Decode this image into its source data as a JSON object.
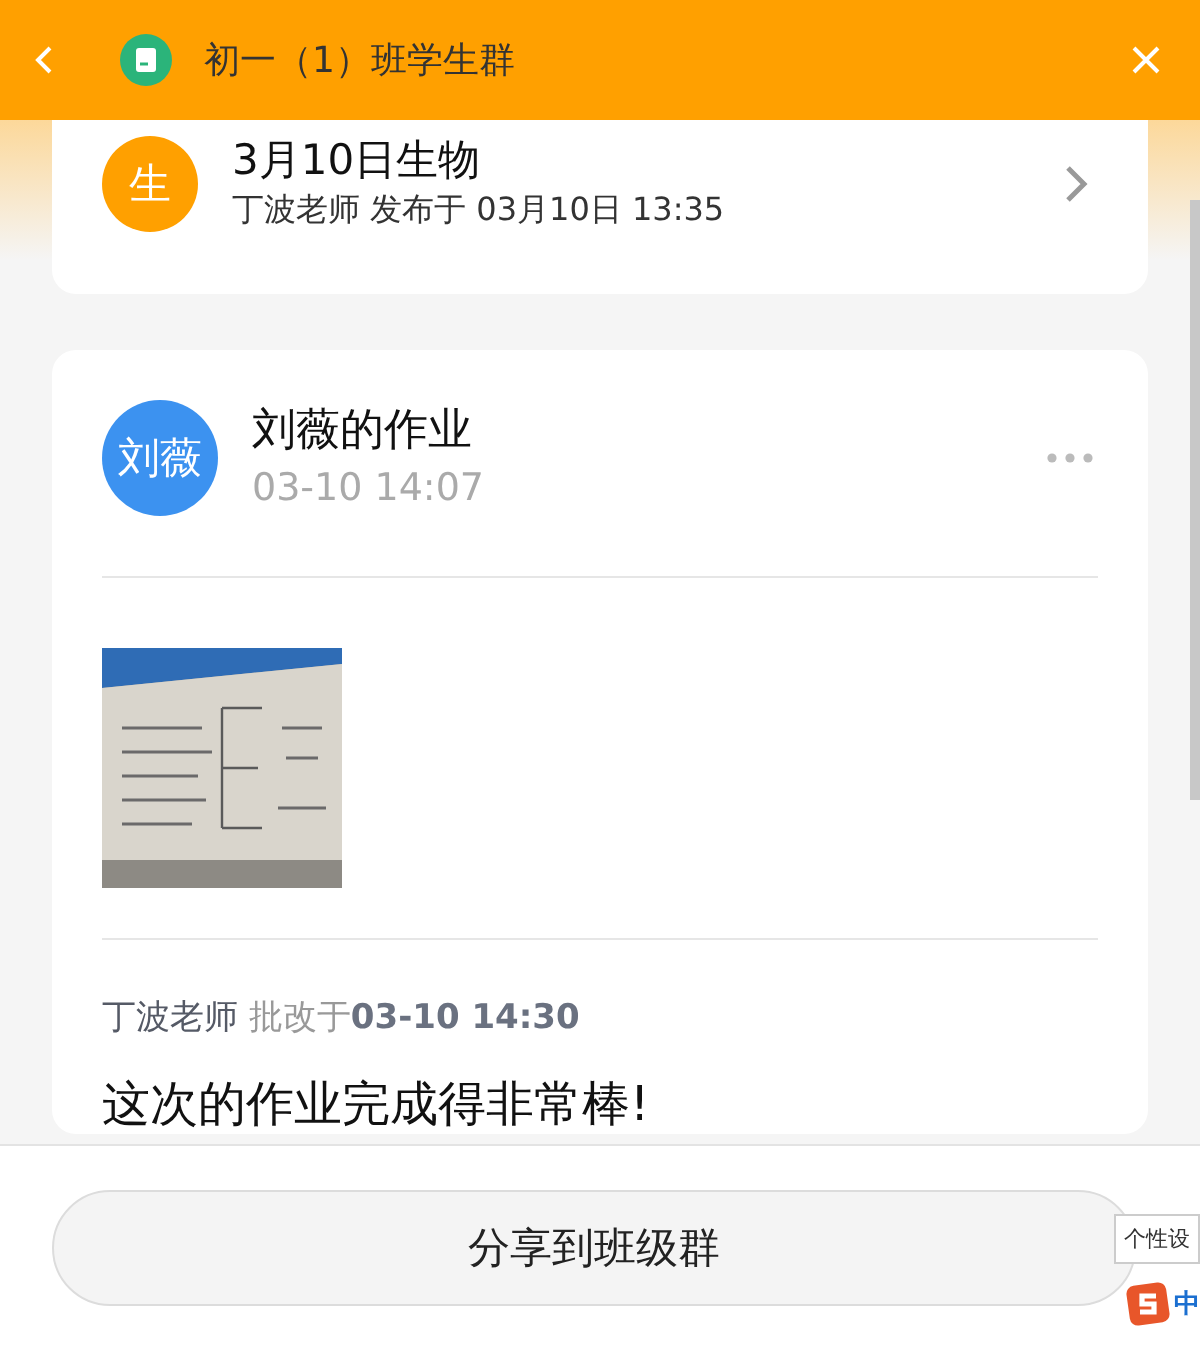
{
  "header": {
    "title": "初一（1）班学生群"
  },
  "assignment": {
    "avatar": "生",
    "title": "3月10日生物",
    "meta": "丁波老师 发布于 03月10日 13:35"
  },
  "submission": {
    "avatar": "刘薇",
    "title": "刘薇的作业",
    "time": "03-10 14:07",
    "review": {
      "teacher": "丁波老师",
      "label": "批改于",
      "time": "03-10 14:30"
    },
    "comment": "这次的作业完成得非常棒!"
  },
  "share_button": "分享到班级群",
  "ime": {
    "tooltip": "个性设",
    "mode": "中"
  }
}
